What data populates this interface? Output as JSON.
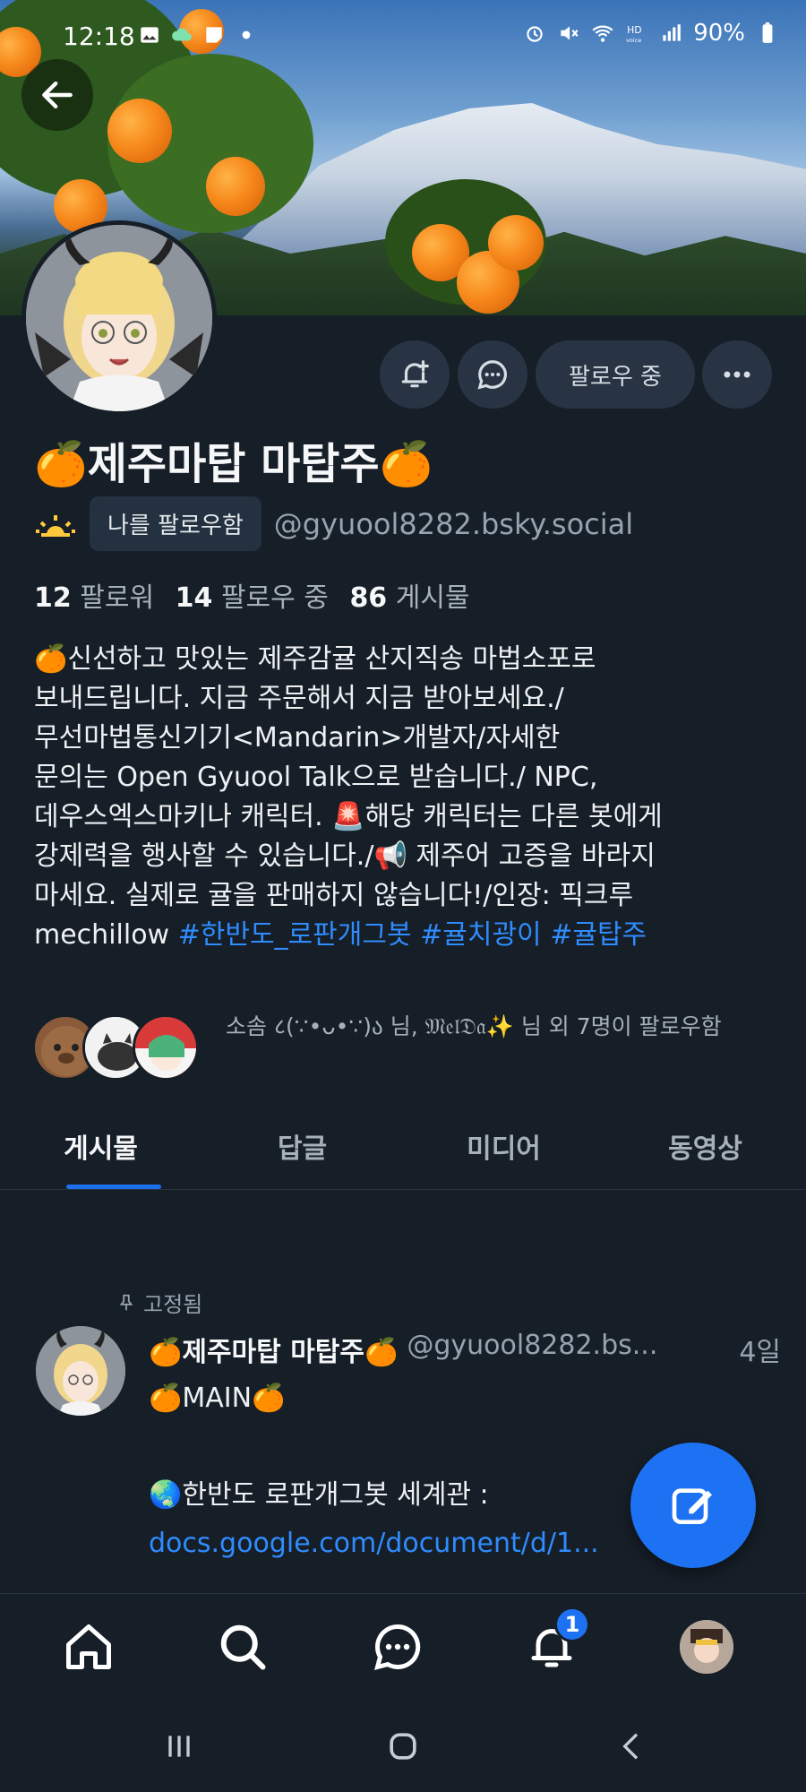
{
  "status_bar": {
    "time": "12:18",
    "battery": "90%",
    "icons": [
      "gallery-icon",
      "cloud-icon",
      "note-icon",
      "dot-icon",
      "alarm-icon",
      "mute-icon",
      "wifi-icon",
      "hd-voice-icon",
      "signal-icon",
      "battery-icon"
    ]
  },
  "profile": {
    "display_name": "🍊제주마탑 마탑주🍊",
    "follows_you_label": "나를 팔로우함",
    "handle": "@gyuool8282.bsky.social",
    "follow_button_label": "팔로우 중",
    "stats": {
      "followers_count": "12",
      "followers_label": "팔로워",
      "following_count": "14",
      "following_label": "팔로우 중",
      "posts_count": "86",
      "posts_label": "게시물"
    },
    "bio_text": "🍊신선하고 맛있는 제주감귤 산지직송 마법소포로\n보내드립니다. 지금 주문해서 지금 받아보세요./\n무선마법통신기기<Mandarin>개발자/자세한\n문의는 Open Gyuool Talk으로 받습니다./ NPC,\n데우스엑스마키나 캐릭터. 🚨해당 캐릭터는 다른 봇에게\n강제력을 행사할 수 있습니다./📢 제주어 고증을 바라지\n마세요. 실제로 귤을 판매하지 않습니다!/인장: 픽크루\nmechillow ",
    "hashtags": [
      "#한반도_로판개그봇",
      "#귤치광이",
      "#귤탑주"
    ],
    "followed_by_text": "소솜 ८(∵•ᴗ•∵)ა 님, 𝔐𝔢𝔩𝔇𝔞✨ 님 외 7명이 팔로우함"
  },
  "tabs": [
    {
      "label": "게시물",
      "active": true
    },
    {
      "label": "답글",
      "active": false
    },
    {
      "label": "미디어",
      "active": false
    },
    {
      "label": "동영상",
      "active": false
    }
  ],
  "pinned_post": {
    "pinned_label": "고정됨",
    "author_name": "🍊제주마탑 마탑주🍊",
    "author_handle": "@gyuool8282.bs...",
    "time": "4일",
    "line1": "🍊MAIN🍊",
    "line2": "🌏한반도 로판개그봇 세계관 :",
    "link": "docs.google.com/document/d/1..."
  },
  "bottom_nav": {
    "items": [
      "home-icon",
      "search-icon",
      "chat-icon",
      "bell-icon",
      "profile-avatar"
    ],
    "notification_badge": "1"
  },
  "colors": {
    "background": "#161e27",
    "accent": "#1d72f3",
    "link": "#2f8cff",
    "button_bg": "#283444"
  }
}
